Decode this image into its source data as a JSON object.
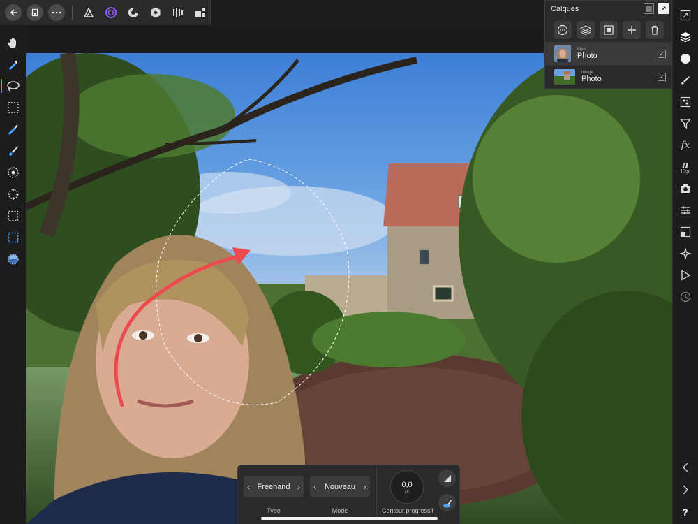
{
  "top_bar": {
    "back_icon": "back-arrow-icon",
    "document_icon": "document-icon",
    "more_icon": "more-icon",
    "personas": [
      "photo-persona-icon",
      "liquify-persona-icon",
      "develop-persona-icon",
      "tone-mapping-persona-icon",
      "export-persona-icon"
    ]
  },
  "left_tools": [
    "hand-icon",
    "color-picker-icon",
    "freehand-selection-icon",
    "rectangle-marquee-icon",
    "selection-brush-icon",
    "paint-brush-icon",
    "flood-select-icon",
    "marquee-selection-icon",
    "rectangle-select-icon",
    "ellipse-select-icon",
    "refine-selection-icon"
  ],
  "layers_panel": {
    "title": "Calques",
    "actions": [
      "more-icon",
      "layers-stack-icon",
      "mask-icon",
      "plus-icon",
      "trash-icon"
    ],
    "layers": [
      {
        "type": "Pixel",
        "name": "Photo",
        "visible": true,
        "selected": true
      },
      {
        "type": "Image",
        "name": "Photo",
        "visible": true,
        "selected": false
      }
    ]
  },
  "right_tabs": {
    "text_size": "12pt",
    "icons": [
      "navigator-icon",
      "layers-icon",
      "color-icon",
      "brush-icon",
      "channels-icon",
      "filter-icon",
      "fx-icon",
      "text-icon",
      "camera-icon",
      "adjustments-icon",
      "transform-icon",
      "tone-icon",
      "play-icon",
      "history-icon"
    ]
  },
  "context_toolbar": {
    "type_value": "Freehand",
    "type_label": "Type",
    "mode_value": "Nouveau",
    "mode_label": "Mode",
    "feather_value": "0,0",
    "feather_unit": "pt",
    "feather_label": "Contour progressif"
  },
  "bottom_nav": {
    "help_label": "?"
  }
}
